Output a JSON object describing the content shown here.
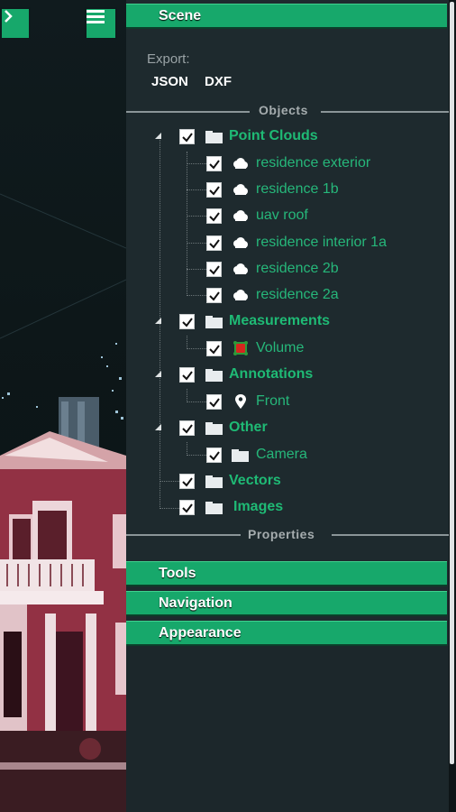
{
  "colors": {
    "accent": "#17a86b",
    "panel": "#1e2a2e",
    "label_green": "#26b77a"
  },
  "sections": {
    "scene": "Scene",
    "tools": "Tools",
    "navigation": "Navigation",
    "appearance": "Appearance"
  },
  "export": {
    "label": "Export:",
    "json": "JSON",
    "dxf": "DXF"
  },
  "dividers": {
    "objects": "Objects",
    "properties": "Properties"
  },
  "tree": {
    "point_clouds": {
      "label": "Point Clouds",
      "items": [
        "residence exterior",
        "residence 1b",
        "uav roof",
        "residence interior 1a",
        "residence 2b",
        "residence 2a"
      ]
    },
    "measurements": {
      "label": "Measurements",
      "items": [
        "Volume"
      ]
    },
    "annotations": {
      "label": "Annotations",
      "items": [
        "Front"
      ]
    },
    "other": {
      "label": "Other",
      "items": [
        "Camera"
      ]
    },
    "vectors": {
      "label": "Vectors"
    },
    "images": {
      "label": "Images"
    }
  },
  "icons": {
    "expand": "chevron-right-icon",
    "menu": "hamburger-menu-icon",
    "folder": "folder-icon",
    "cloud": "cloud-icon",
    "volume": "volume-measure-icon",
    "annotation": "map-pin-icon"
  }
}
